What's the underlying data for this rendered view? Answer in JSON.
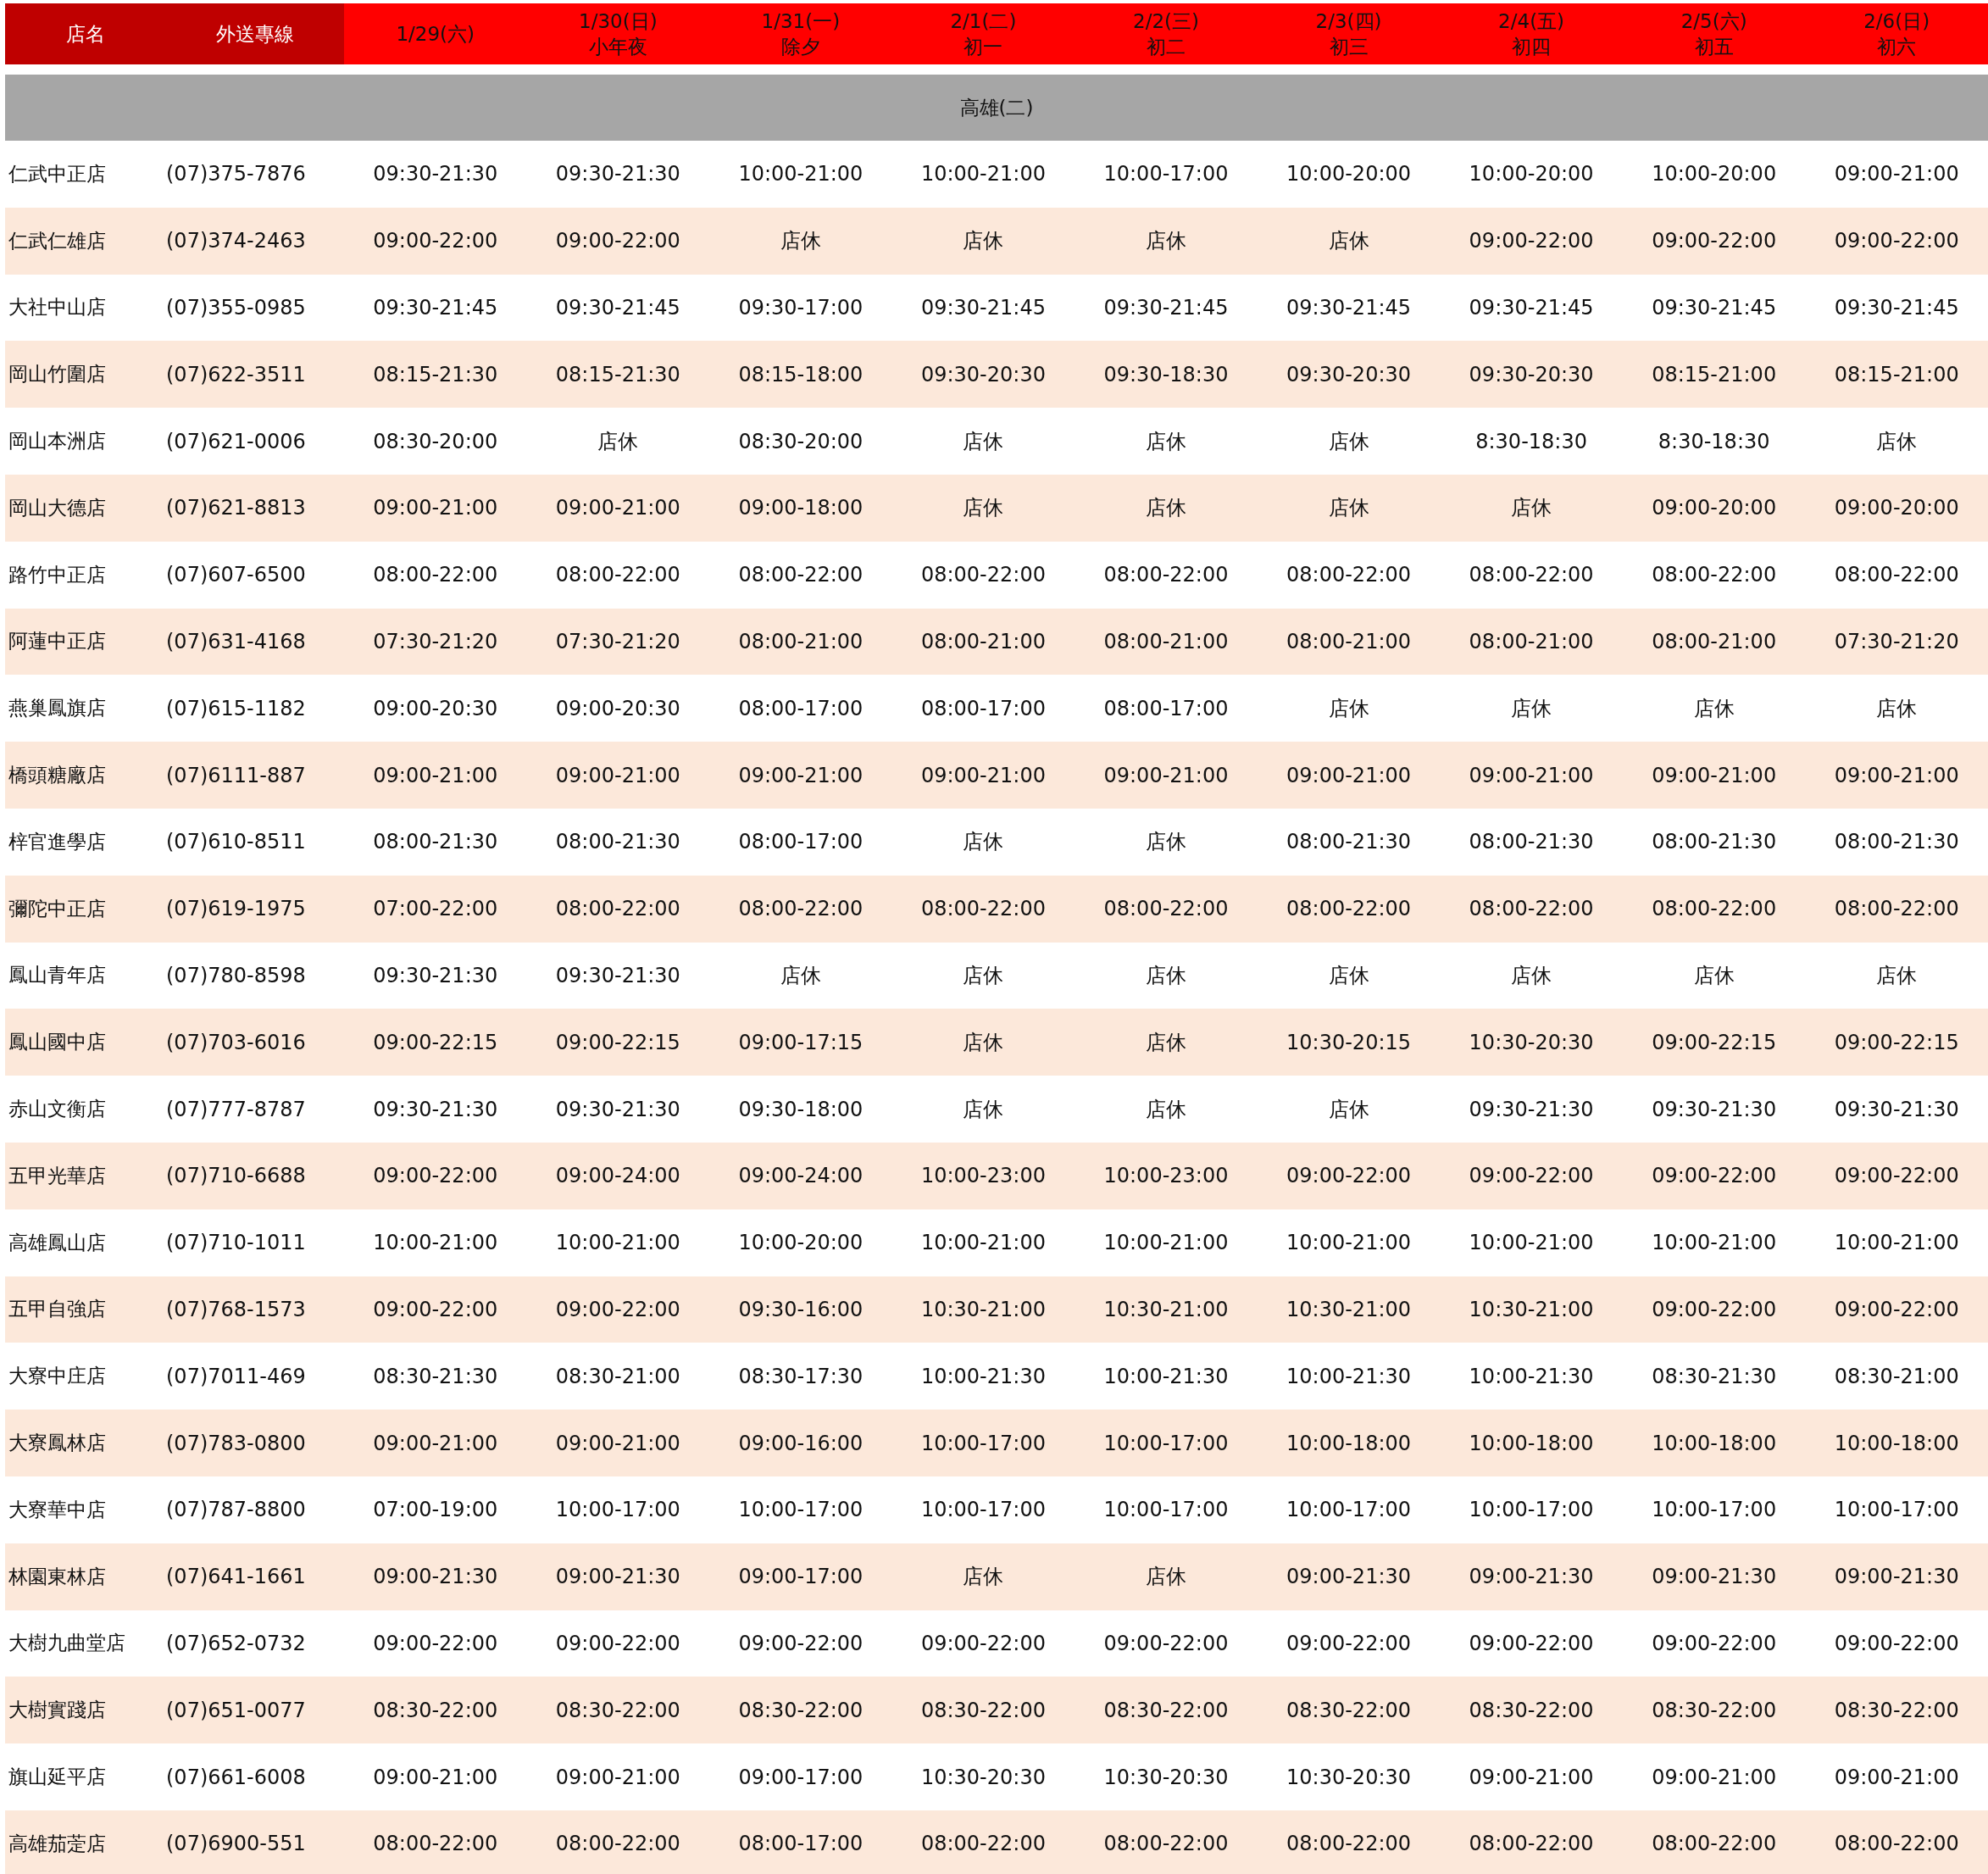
{
  "header": {
    "store": "店名",
    "phone": "外送專線",
    "days": [
      {
        "date": "1/29(六)"
      },
      {
        "date": "1/30(日)",
        "note": "小年夜"
      },
      {
        "date": "1/31(一)",
        "note": "除夕"
      },
      {
        "date": "2/1(二)",
        "note": "初一"
      },
      {
        "date": "2/2(三)",
        "note": "初二"
      },
      {
        "date": "2/3(四)",
        "note": "初三"
      },
      {
        "date": "2/4(五)",
        "note": "初四"
      },
      {
        "date": "2/5(六)",
        "note": "初五"
      },
      {
        "date": "2/6(日)",
        "note": "初六"
      }
    ]
  },
  "section": "高雄(二)",
  "rows": [
    {
      "store": "仁武中正店",
      "phone": "(07)375-7876",
      "hours": [
        "09:30-21:30",
        "09:30-21:30",
        "10:00-21:00",
        "10:00-21:00",
        "10:00-17:00",
        "10:00-20:00",
        "10:00-20:00",
        "10:00-20:00",
        "09:00-21:00"
      ]
    },
    {
      "store": "仁武仁雄店",
      "phone": "(07)374-2463",
      "hours": [
        "09:00-22:00",
        "09:00-22:00",
        "店休",
        "店休",
        "店休",
        "店休",
        "09:00-22:00",
        "09:00-22:00",
        "09:00-22:00"
      ]
    },
    {
      "store": "大社中山店",
      "phone": "(07)355-0985",
      "hours": [
        "09:30-21:45",
        "09:30-21:45",
        "09:30-17:00",
        "09:30-21:45",
        "09:30-21:45",
        "09:30-21:45",
        "09:30-21:45",
        "09:30-21:45",
        "09:30-21:45"
      ]
    },
    {
      "store": "岡山竹圍店",
      "phone": "(07)622-3511",
      "hours": [
        "08:15-21:30",
        "08:15-21:30",
        "08:15-18:00",
        "09:30-20:30",
        "09:30-18:30",
        "09:30-20:30",
        "09:30-20:30",
        "08:15-21:00",
        "08:15-21:00"
      ]
    },
    {
      "store": "岡山本洲店",
      "phone": "(07)621-0006",
      "hours": [
        "08:30-20:00",
        "店休",
        "08:30-20:00",
        "店休",
        "店休",
        "店休",
        "8:30-18:30",
        "8:30-18:30",
        "店休"
      ]
    },
    {
      "store": "岡山大德店",
      "phone": "(07)621-8813",
      "hours": [
        "09:00-21:00",
        "09:00-21:00",
        "09:00-18:00",
        "店休",
        "店休",
        "店休",
        "店休",
        "09:00-20:00",
        "09:00-20:00"
      ]
    },
    {
      "store": "路竹中正店",
      "phone": "(07)607-6500",
      "hours": [
        "08:00-22:00",
        "08:00-22:00",
        "08:00-22:00",
        "08:00-22:00",
        "08:00-22:00",
        "08:00-22:00",
        "08:00-22:00",
        "08:00-22:00",
        "08:00-22:00"
      ]
    },
    {
      "store": "阿蓮中正店",
      "phone": "(07)631-4168",
      "hours": [
        "07:30-21:20",
        "07:30-21:20",
        "08:00-21:00",
        "08:00-21:00",
        "08:00-21:00",
        "08:00-21:00",
        "08:00-21:00",
        "08:00-21:00",
        "07:30-21:20"
      ]
    },
    {
      "store": "燕巢鳳旗店",
      "phone": "(07)615-1182",
      "hours": [
        "09:00-20:30",
        "09:00-20:30",
        "08:00-17:00",
        "08:00-17:00",
        "08:00-17:00",
        "店休",
        "店休",
        "店休",
        "店休"
      ]
    },
    {
      "store": "橋頭糖廠店",
      "phone": "(07)6111-887",
      "hours": [
        "09:00-21:00",
        "09:00-21:00",
        "09:00-21:00",
        "09:00-21:00",
        "09:00-21:00",
        "09:00-21:00",
        "09:00-21:00",
        "09:00-21:00",
        "09:00-21:00"
      ]
    },
    {
      "store": "梓官進學店",
      "phone": "(07)610-8511",
      "hours": [
        "08:00-21:30",
        "08:00-21:30",
        "08:00-17:00",
        "店休",
        "店休",
        "08:00-21:30",
        "08:00-21:30",
        "08:00-21:30",
        "08:00-21:30"
      ]
    },
    {
      "store": "彌陀中正店",
      "phone": "(07)619-1975",
      "hours": [
        "07:00-22:00",
        "08:00-22:00",
        "08:00-22:00",
        "08:00-22:00",
        "08:00-22:00",
        "08:00-22:00",
        "08:00-22:00",
        "08:00-22:00",
        "08:00-22:00"
      ]
    },
    {
      "store": "鳳山青年店",
      "phone": "(07)780-8598",
      "hours": [
        "09:30-21:30",
        "09:30-21:30",
        "店休",
        "店休",
        "店休",
        "店休",
        "店休",
        "店休",
        "店休"
      ]
    },
    {
      "store": "鳳山國中店",
      "phone": "(07)703-6016",
      "hours": [
        "09:00-22:15",
        "09:00-22:15",
        "09:00-17:15",
        "店休",
        "店休",
        "10:30-20:15",
        "10:30-20:30",
        "09:00-22:15",
        "09:00-22:15"
      ]
    },
    {
      "store": "赤山文衡店",
      "phone": "(07)777-8787",
      "hours": [
        "09:30-21:30",
        "09:30-21:30",
        "09:30-18:00",
        "店休",
        "店休",
        "店休",
        "09:30-21:30",
        "09:30-21:30",
        "09:30-21:30"
      ]
    },
    {
      "store": "五甲光華店",
      "phone": "(07)710-6688",
      "hours": [
        "09:00-22:00",
        "09:00-24:00",
        "09:00-24:00",
        "10:00-23:00",
        "10:00-23:00",
        "09:00-22:00",
        "09:00-22:00",
        "09:00-22:00",
        "09:00-22:00"
      ]
    },
    {
      "store": "高雄鳳山店",
      "phone": "(07)710-1011",
      "hours": [
        "10:00-21:00",
        "10:00-21:00",
        "10:00-20:00",
        "10:00-21:00",
        "10:00-21:00",
        "10:00-21:00",
        "10:00-21:00",
        "10:00-21:00",
        "10:00-21:00"
      ]
    },
    {
      "store": "五甲自強店",
      "phone": "(07)768-1573",
      "hours": [
        "09:00-22:00",
        "09:00-22:00",
        "09:30-16:00",
        "10:30-21:00",
        "10:30-21:00",
        "10:30-21:00",
        "10:30-21:00",
        "09:00-22:00",
        "09:00-22:00"
      ]
    },
    {
      "store": "大寮中庄店",
      "phone": "(07)7011-469",
      "hours": [
        "08:30-21:30",
        "08:30-21:00",
        "08:30-17:30",
        "10:00-21:30",
        "10:00-21:30",
        "10:00-21:30",
        "10:00-21:30",
        "08:30-21:30",
        "08:30-21:00"
      ]
    },
    {
      "store": "大寮鳳林店",
      "phone": "(07)783-0800",
      "hours": [
        "09:00-21:00",
        "09:00-21:00",
        "09:00-16:00",
        "10:00-17:00",
        "10:00-17:00",
        "10:00-18:00",
        "10:00-18:00",
        "10:00-18:00",
        "10:00-18:00"
      ]
    },
    {
      "store": "大寮華中店",
      "phone": "(07)787-8800",
      "hours": [
        "07:00-19:00",
        "10:00-17:00",
        "10:00-17:00",
        "10:00-17:00",
        "10:00-17:00",
        "10:00-17:00",
        "10:00-17:00",
        "10:00-17:00",
        "10:00-17:00"
      ]
    },
    {
      "store": "林園東林店",
      "phone": "(07)641-1661",
      "hours": [
        "09:00-21:30",
        "09:00-21:30",
        "09:00-17:00",
        "店休",
        "店休",
        "09:00-21:30",
        "09:00-21:30",
        "09:00-21:30",
        "09:00-21:30"
      ]
    },
    {
      "store": "大樹九曲堂店",
      "phone": "(07)652-0732",
      "hours": [
        "09:00-22:00",
        "09:00-22:00",
        "09:00-22:00",
        "09:00-22:00",
        "09:00-22:00",
        "09:00-22:00",
        "09:00-22:00",
        "09:00-22:00",
        "09:00-22:00"
      ]
    },
    {
      "store": "大樹實踐店",
      "phone": "(07)651-0077",
      "hours": [
        "08:30-22:00",
        "08:30-22:00",
        "08:30-22:00",
        "08:30-22:00",
        "08:30-22:00",
        "08:30-22:00",
        "08:30-22:00",
        "08:30-22:00",
        "08:30-22:00"
      ]
    },
    {
      "store": "旗山延平店",
      "phone": "(07)661-6008",
      "hours": [
        "09:00-21:00",
        "09:00-21:00",
        "09:00-17:00",
        "10:30-20:30",
        "10:30-20:30",
        "10:30-20:30",
        "09:00-21:00",
        "09:00-21:00",
        "09:00-21:00"
      ]
    },
    {
      "store": "高雄茄萣店",
      "phone": "(07)6900-551",
      "hours": [
        "08:00-22:00",
        "08:00-22:00",
        "08:00-17:00",
        "08:00-22:00",
        "08:00-22:00",
        "08:00-22:00",
        "08:00-22:00",
        "08:00-22:00",
        "08:00-22:00"
      ]
    }
  ]
}
